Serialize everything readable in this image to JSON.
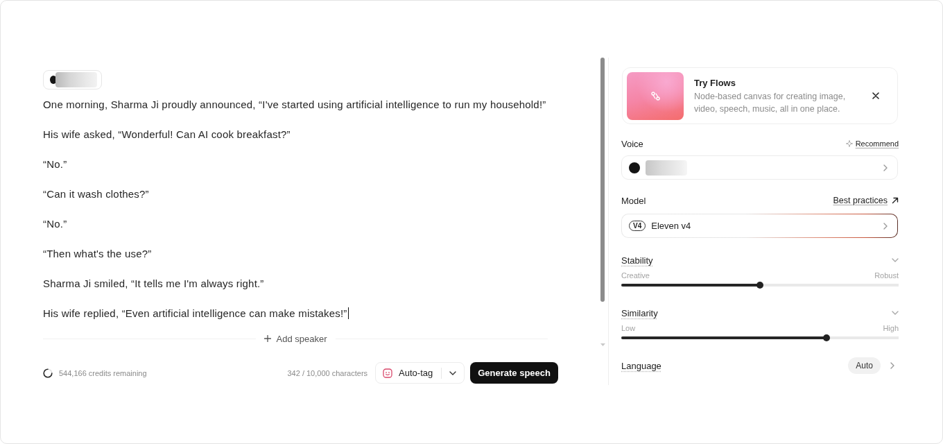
{
  "editor": {
    "paragraphs": [
      "One morning, Sharma Ji proudly announced, “I've started using artificial intelligence to run my household!”",
      "His wife asked, “Wonderful! Can AI cook breakfast?”",
      "“No.”",
      "“Can it wash clothes?”",
      "“No.”",
      "“Then what's the use?”",
      "Sharma Ji smiled, “It tells me I'm always right.”",
      "His wife replied, “Even artificial intelligence can make mistakes!”"
    ],
    "text_cursor": true,
    "add_speaker": "Add speaker"
  },
  "footer": {
    "credits": "544,166 credits remaining",
    "characters": "342 / 10,000 characters",
    "auto_tag": "Auto-tag",
    "generate": "Generate speech"
  },
  "settings": {
    "promo": {
      "title": "Try Flows",
      "description": "Node-based canvas for creating image, video, speech, music, all in one place."
    },
    "voice": {
      "label": "Voice",
      "action": "Recommend"
    },
    "model": {
      "label": "Model",
      "link": "Best practices",
      "badge": "V4",
      "value": "Eleven v4"
    },
    "sliders": [
      {
        "label": "Stability",
        "min_label": "Creative",
        "max_label": "Robust",
        "level": 0.5
      },
      {
        "label": "Similarity",
        "min_label": "Low",
        "max_label": "High",
        "level": 0.74
      }
    ],
    "language": {
      "label": "Language",
      "value": "Auto"
    }
  }
}
